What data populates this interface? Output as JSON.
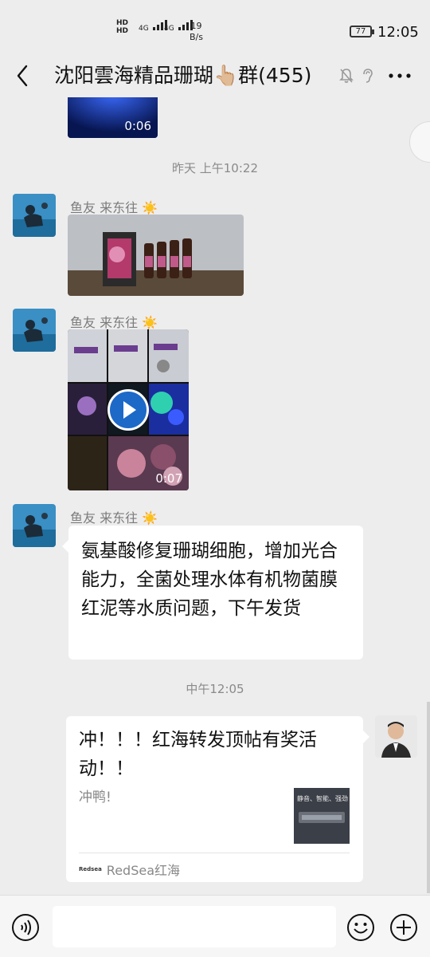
{
  "status_bar": {
    "net1": "HD",
    "net2": "HD",
    "sig1": "4G",
    "sig2": "4G",
    "speed_value": "19",
    "speed_unit": "B/s",
    "battery": "77",
    "time": "12:05"
  },
  "header": {
    "title": "沈阳雲海精品珊瑚👆🏼群(455)"
  },
  "messages": [
    {
      "type": "video",
      "duration": "0:06"
    },
    {
      "type": "timestamp",
      "text": "昨天 上午10:22"
    },
    {
      "type": "image",
      "sender": "鱼友 来东往 ☀️"
    },
    {
      "type": "video",
      "sender": "鱼友 来东往 ☀️",
      "duration": "0:07"
    },
    {
      "type": "text",
      "sender": "鱼友 来东往 ☀️",
      "text": "氨基酸修复珊瑚细胞，增加光合能力，全菌处理水体有机物菌膜红泥等水质问题，下午发货"
    },
    {
      "type": "timestamp",
      "text": "中午12:05"
    },
    {
      "type": "link_card",
      "title": "冲！！！红海转发顶帖有奖活动！！",
      "desc": "冲鸭!",
      "thumb_caption": "静音、智能、强劲",
      "source_logo": "Redsea",
      "source": "RedSea红海"
    }
  ],
  "colors": {
    "background": "#ededed",
    "bubble": "#ffffff",
    "timestamp": "#8a8a8a"
  },
  "icons": [
    "back-arrow-icon",
    "mute-bell-icon",
    "ear-icon",
    "more-icon",
    "voice-icon",
    "emoji-icon",
    "plus-icon",
    "play-icon"
  ]
}
